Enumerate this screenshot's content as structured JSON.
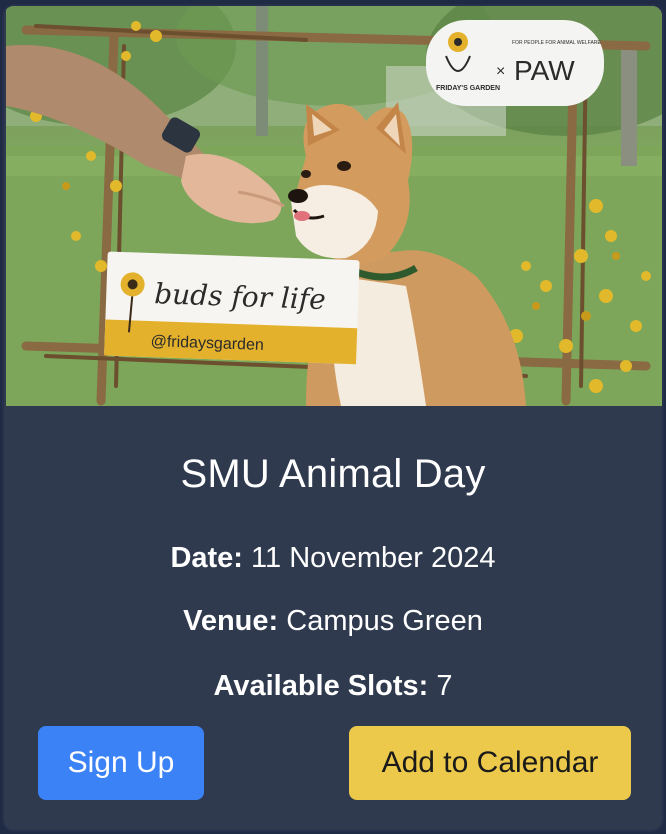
{
  "event": {
    "image_alt": "Shiba Inu dog being fed a treat inside a floral frame",
    "sign_main": "buds for life",
    "sign_handle": "@fridaysgarden",
    "logo_left": "FRIDAY'S GARDEN",
    "logo_x": "×",
    "logo_right": "PAW",
    "logo_tag": "FOR PEOPLE FOR ANIMAL WELFARE",
    "title": "SMU Animal Day",
    "date_label": "Date:",
    "date_value": "11 November 2024",
    "venue_label": "Venue:",
    "venue_value": "Campus Green",
    "slots_label": "Available Slots:",
    "slots_value": "7"
  },
  "actions": {
    "signup_label": "Sign Up",
    "calendar_label": "Add to Calendar"
  },
  "colors": {
    "card_bg": "#2f3a4e",
    "signup_bg": "#3b82f6",
    "calendar_bg": "#ecc94b"
  }
}
